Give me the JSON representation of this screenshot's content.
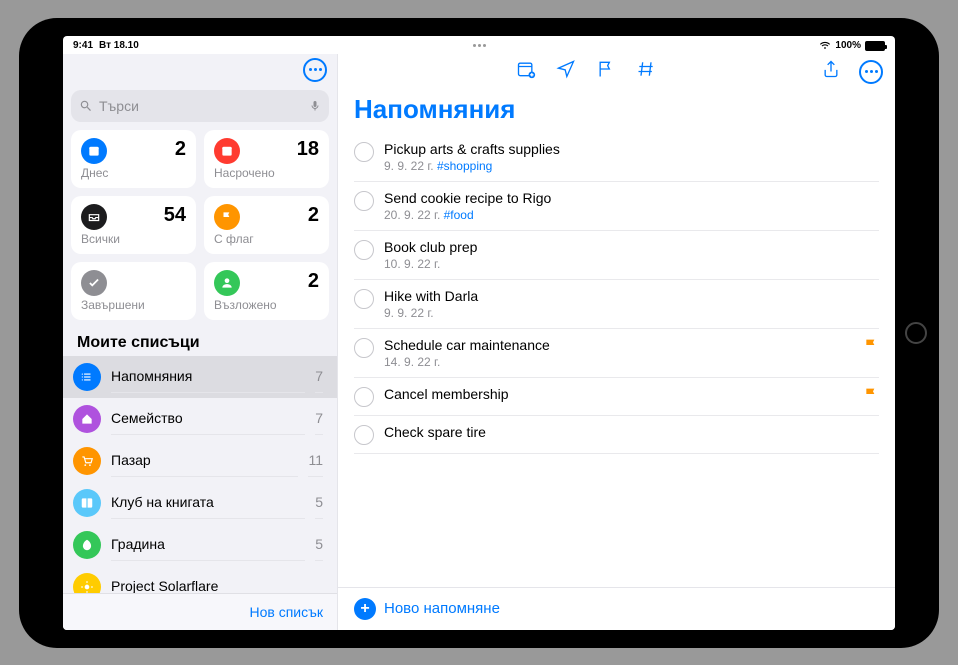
{
  "status": {
    "time": "9:41",
    "date": "Вт 18.10",
    "battery": "100%"
  },
  "sidebar": {
    "search_placeholder": "Търси",
    "smart": [
      {
        "label": "Днес",
        "count": "2",
        "color": "#007aff",
        "icon": "calendar"
      },
      {
        "label": "Насрочено",
        "count": "18",
        "color": "#ff3b30",
        "icon": "calendar"
      },
      {
        "label": "Всички",
        "count": "54",
        "color": "#1c1c1e",
        "icon": "tray"
      },
      {
        "label": "С флаг",
        "count": "2",
        "color": "#ff9500",
        "icon": "flag"
      },
      {
        "label": "Завършени",
        "count": "",
        "color": "#8e8e93",
        "icon": "check"
      },
      {
        "label": "Възложено",
        "count": "2",
        "color": "#34c759",
        "icon": "person"
      }
    ],
    "lists_header": "Моите списъци",
    "lists": [
      {
        "name": "Напомняния",
        "count": "7",
        "color": "#007aff",
        "icon": "list"
      },
      {
        "name": "Семейство",
        "count": "7",
        "color": "#af52de",
        "icon": "house"
      },
      {
        "name": "Пазар",
        "count": "11",
        "color": "#ff9500",
        "icon": "cart"
      },
      {
        "name": "Клуб на книгата",
        "count": "5",
        "color": "#5ac8fa",
        "icon": "book"
      },
      {
        "name": "Градина",
        "count": "5",
        "color": "#34c759",
        "icon": "leaf"
      },
      {
        "name": "Project Solarflare",
        "count": "",
        "color": "#ffcc00",
        "icon": "sun"
      }
    ],
    "new_list": "Нов списък"
  },
  "detail": {
    "title": "Напомняния",
    "reminders": [
      {
        "title": "Pickup arts & crafts supplies",
        "date": "9. 9. 22 г.",
        "tag": "#shopping",
        "flagged": false
      },
      {
        "title": "Send cookie recipe to Rigo",
        "date": "20. 9. 22 г.",
        "tag": "#food",
        "flagged": false
      },
      {
        "title": "Book club prep",
        "date": "10. 9. 22 г.",
        "tag": "",
        "flagged": false
      },
      {
        "title": "Hike with Darla",
        "date": "9. 9. 22 г.",
        "tag": "",
        "flagged": false
      },
      {
        "title": "Schedule car maintenance",
        "date": "14. 9. 22 г.",
        "tag": "",
        "flagged": true
      },
      {
        "title": "Cancel membership",
        "date": "",
        "tag": "",
        "flagged": true
      },
      {
        "title": "Check spare tire",
        "date": "",
        "tag": "",
        "flagged": false
      }
    ],
    "new_reminder": "Ново напомняне"
  }
}
